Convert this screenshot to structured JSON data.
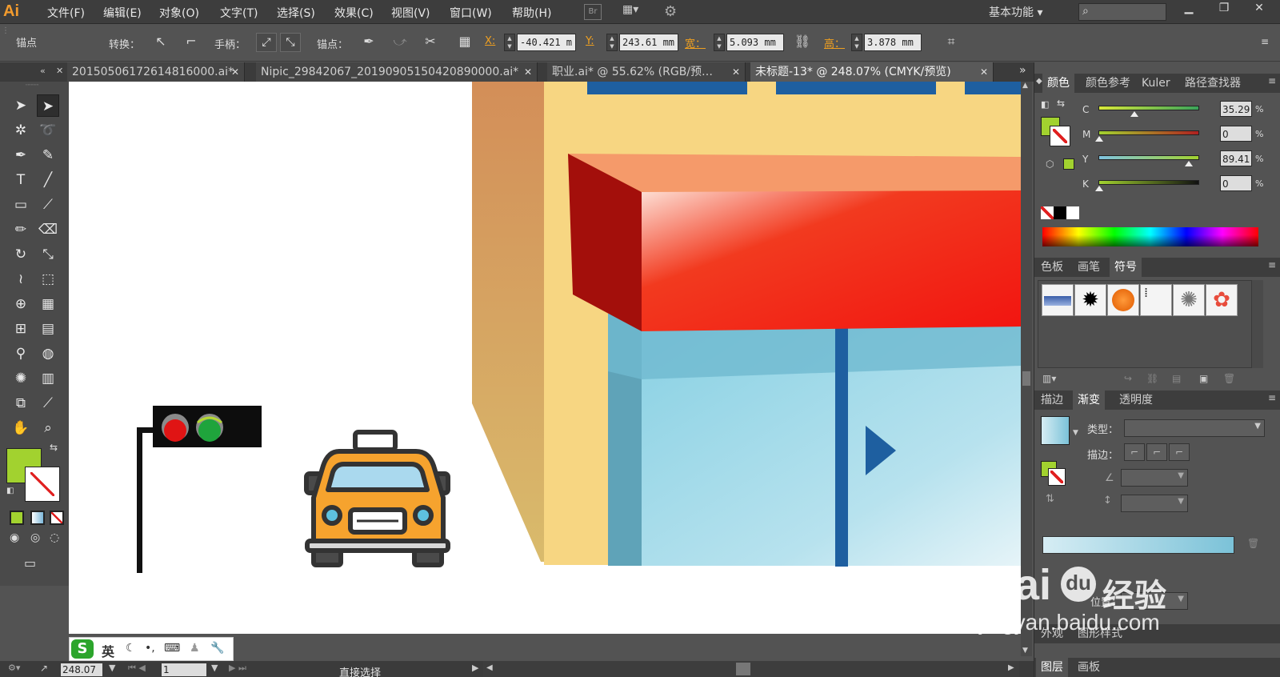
{
  "app": {
    "logo": "Ai"
  },
  "menu": {
    "items": [
      "文件(F)",
      "编辑(E)",
      "对象(O)",
      "文字(T)",
      "选择(S)",
      "效果(C)",
      "视图(V)",
      "窗口(W)",
      "帮助(H)"
    ],
    "br_label": "Br",
    "workspace": "基本功能 ▾",
    "search_placeholder": ""
  },
  "control_bar": {
    "mode_label": "锚点",
    "convert_label": "转换：",
    "handle_label": "手柄：",
    "anchor_label": "锚点：",
    "x_label": "X:",
    "x_value": "-40.421 m",
    "y_label": "Y:",
    "y_value": "243.61 mm",
    "w_label": "宽：",
    "w_value": "5.093 mm",
    "h_label": "高：",
    "h_value": "3.878 mm"
  },
  "tabs": [
    {
      "label": "20150506172614816000.ai*",
      "active": false
    },
    {
      "label": "Nipic_29842067_20190905150420890000.ai*",
      "active": false
    },
    {
      "label": "职业.ai* @ 55.62% (RGB/预…",
      "active": false
    },
    {
      "label": "未标题-13* @ 248.07% (CMYK/预览)",
      "active": true
    }
  ],
  "toolbox": {
    "fill_color": "#a2d22f",
    "tools": [
      "selection-tool-icon",
      "direct-selection-tool-icon",
      "magic-wand-tool-icon",
      "lasso-tool-icon",
      "pen-tool-icon",
      "curvature-tool-icon",
      "type-tool-icon",
      "line-tool-icon",
      "rectangle-tool-icon",
      "paintbrush-tool-icon",
      "pencil-tool-icon",
      "eraser-tool-icon",
      "rotate-tool-icon",
      "scale-tool-icon",
      "warp-tool-icon",
      "free-transform-tool-icon",
      "shape-builder-tool-icon",
      "perspective-grid-tool-icon",
      "mesh-tool-icon",
      "gradient-tool-icon",
      "eyedropper-tool-icon",
      "blend-tool-icon",
      "symbol-sprayer-tool-icon",
      "graph-tool-icon",
      "artboard-tool-icon",
      "slice-tool-icon",
      "hand-tool-icon",
      "zoom-tool-icon"
    ]
  },
  "status": {
    "zoom": "248.07",
    "page": "1",
    "current_tool": "直接选择"
  },
  "ime": {
    "logo": "S",
    "lang": "英"
  },
  "panels": {
    "color": {
      "tabs": [
        "颜色",
        "颜色参考",
        "Kuler",
        "路径查找器"
      ],
      "channels": [
        {
          "name": "C",
          "value": "35.29",
          "percent": 0.35
        },
        {
          "name": "M",
          "value": "0",
          "percent": 0.0
        },
        {
          "name": "Y",
          "value": "89.41",
          "percent": 0.89
        },
        {
          "name": "K",
          "value": "0",
          "percent": 0.0
        }
      ],
      "percent_sign": "%"
    },
    "symbols": {
      "tabs": [
        "色板",
        "画笔",
        "符号"
      ]
    },
    "gradient": {
      "tabs": [
        "描边",
        "渐变",
        "透明度"
      ],
      "type_label": "类型：",
      "stroke_label": "描边：",
      "location_label": "位置："
    },
    "appearance": {
      "tabs": [
        "外观",
        "图形样式"
      ]
    },
    "layers": {
      "tabs": [
        "图层",
        "画板"
      ]
    }
  },
  "watermark": {
    "brand": "Bai",
    "brand_du": "du",
    "brand_cn": "经验",
    "url": "jingyan.baidu.com"
  }
}
